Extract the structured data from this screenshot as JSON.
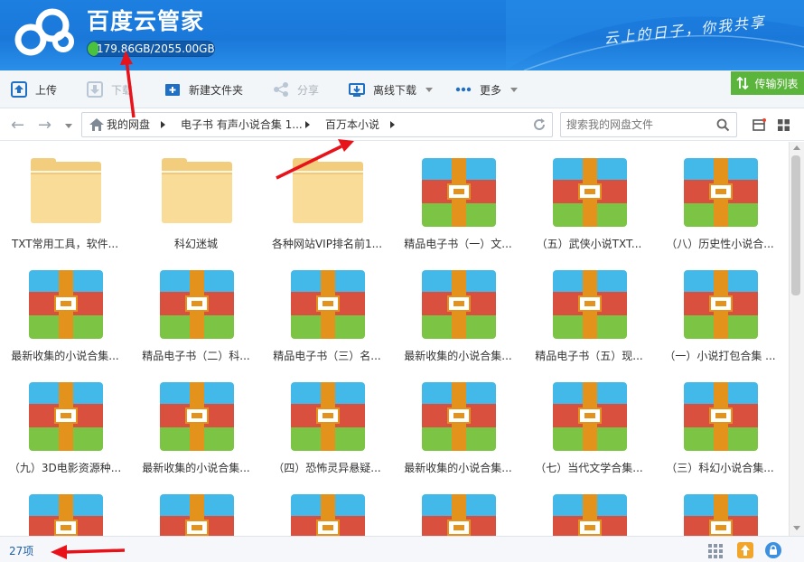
{
  "app": {
    "title": "百度云管家",
    "quota_text": "179.86GB/2055.00GB",
    "quota_fraction": 0.0875,
    "slogan": "云上的日子，你我共享"
  },
  "toolbar": {
    "upload": "上传",
    "download": "下载",
    "new_folder": "新建文件夹",
    "share": "分享",
    "offline_download": "离线下载",
    "more": "更多",
    "transfer_list": "传输列表"
  },
  "nav": {
    "breadcrumbs": [
      "我的网盘",
      "电子书 有声小说合集 1...",
      "百万本小说"
    ],
    "search_placeholder": "搜索我的网盘文件"
  },
  "files": [
    {
      "name": "TXT常用工具，软件...",
      "kind": "folder"
    },
    {
      "name": "科幻迷城",
      "kind": "folder"
    },
    {
      "name": "各种网站VIP排名前1...",
      "kind": "folder"
    },
    {
      "name": "精品电子书（一）文...",
      "kind": "rar"
    },
    {
      "name": "（五）武侠小说TXT...",
      "kind": "rar"
    },
    {
      "name": "（八）历史性小说合...",
      "kind": "rar"
    },
    {
      "name": "最新收集的小说合集...",
      "kind": "rar"
    },
    {
      "name": "精品电子书（二）科...",
      "kind": "rar"
    },
    {
      "name": "精品电子书（三）名...",
      "kind": "rar"
    },
    {
      "name": "最新收集的小说合集...",
      "kind": "rar"
    },
    {
      "name": "精品电子书（五）现...",
      "kind": "rar"
    },
    {
      "name": "（一）小说打包合集 ...",
      "kind": "rar"
    },
    {
      "name": "（九）3D电影资源种...",
      "kind": "rar"
    },
    {
      "name": "最新收集的小说合集...",
      "kind": "rar"
    },
    {
      "name": "（四）恐怖灵异悬疑...",
      "kind": "rar"
    },
    {
      "name": "最新收集的小说合集...",
      "kind": "rar"
    },
    {
      "name": "（七）当代文学合集...",
      "kind": "rar"
    },
    {
      "name": "（三）科幻小说合集...",
      "kind": "rar"
    },
    {
      "name": "",
      "kind": "rar"
    },
    {
      "name": "",
      "kind": "rar"
    },
    {
      "name": "",
      "kind": "rar"
    },
    {
      "name": "",
      "kind": "rar"
    },
    {
      "name": "",
      "kind": "rar"
    },
    {
      "name": "",
      "kind": "rar"
    }
  ],
  "status": {
    "item_count": "27项"
  },
  "colors": {
    "header_blue": "#1d7fe0",
    "transfer_green": "#5bb53c",
    "annotation_red": "#e8121b"
  }
}
